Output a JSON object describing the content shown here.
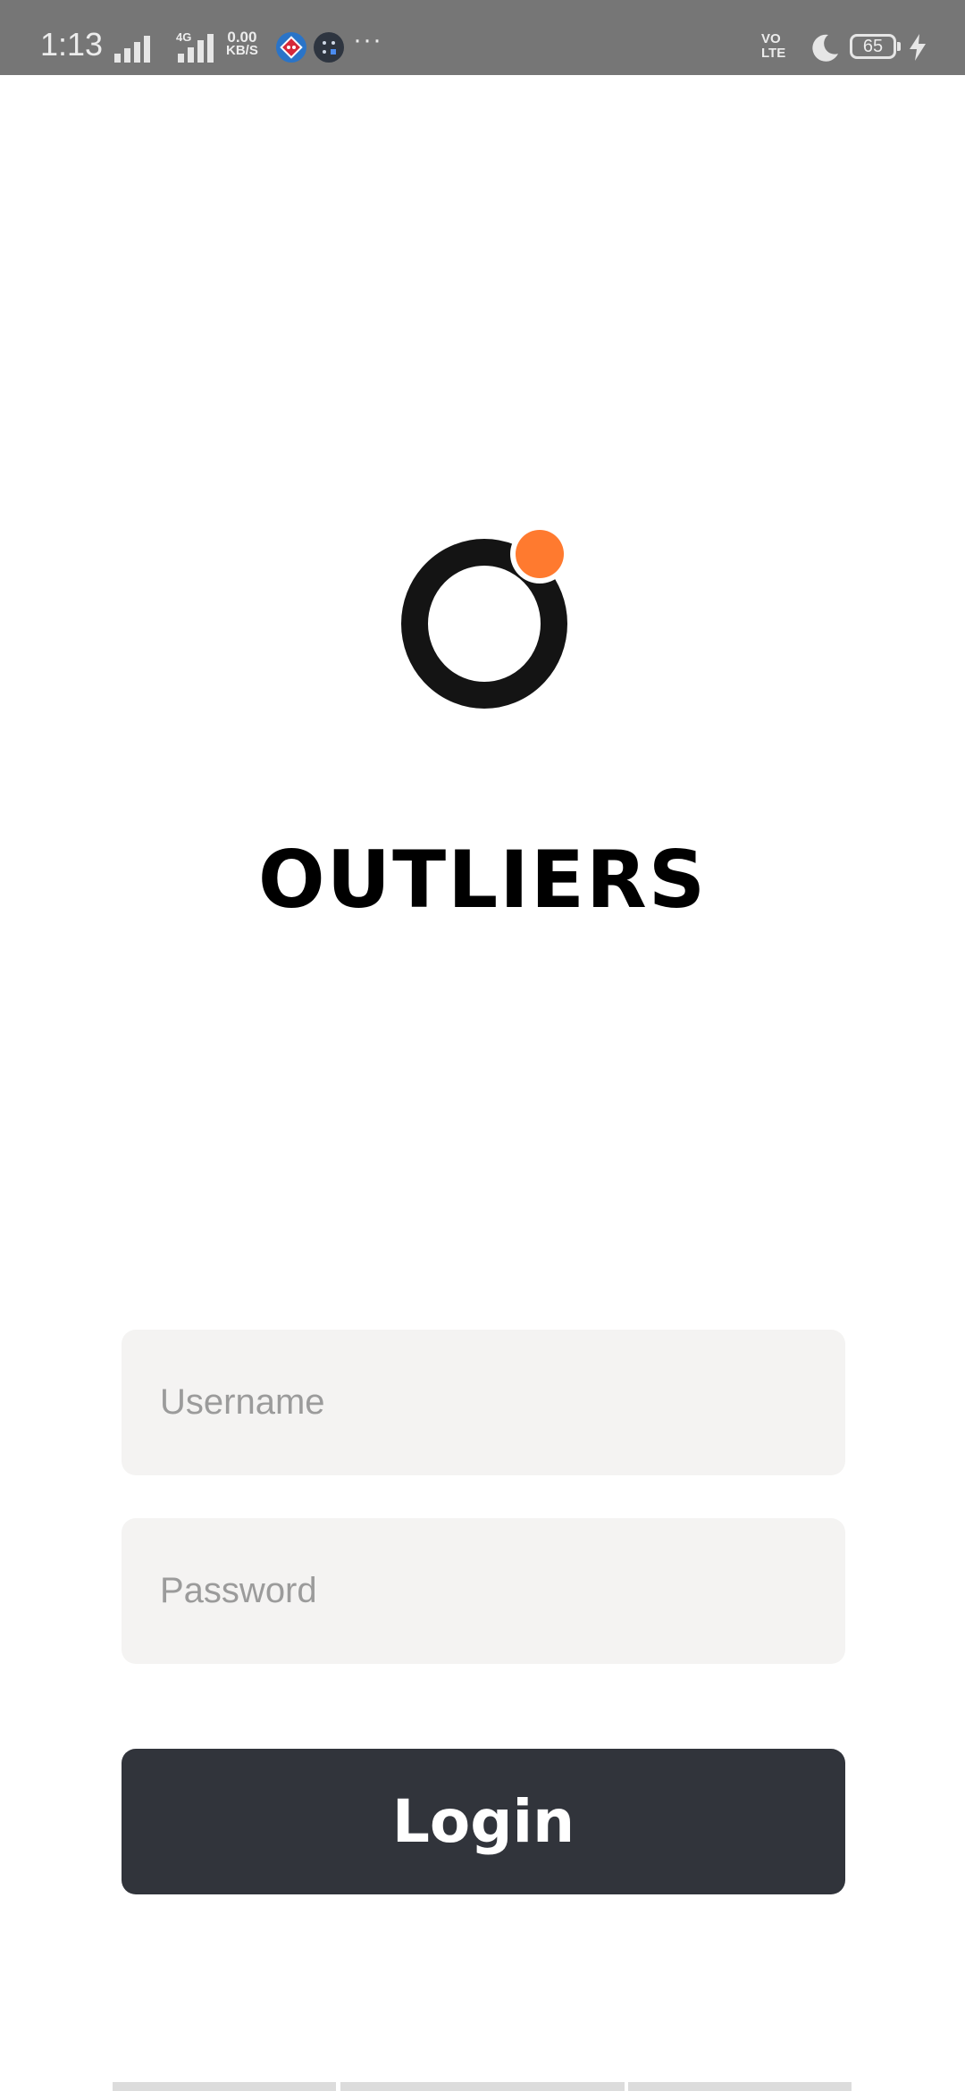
{
  "status_bar": {
    "time": "1:13",
    "network_type": "4G",
    "speed_value": "0.00",
    "speed_unit": "KB/S",
    "more_indicator": "···",
    "volte_line1": "VO",
    "volte_line2": "LTE",
    "battery_level": "65",
    "icons": [
      "signal-icon",
      "signal-4g-icon",
      "dominos-notification-icon",
      "app-notification-icon",
      "moon-icon",
      "battery-icon",
      "charging-bolt-icon"
    ]
  },
  "app": {
    "name": "OUTLIERS",
    "logo_icon": "outliers-logo-icon",
    "accent_color": "#ff7a2f",
    "logo_color": "#141414"
  },
  "login_form": {
    "username_placeholder": "Username",
    "username_value": "",
    "password_placeholder": "Password",
    "password_value": "",
    "login_label": "Login",
    "button_color": "#31343b",
    "field_color": "#f4f3f2"
  }
}
